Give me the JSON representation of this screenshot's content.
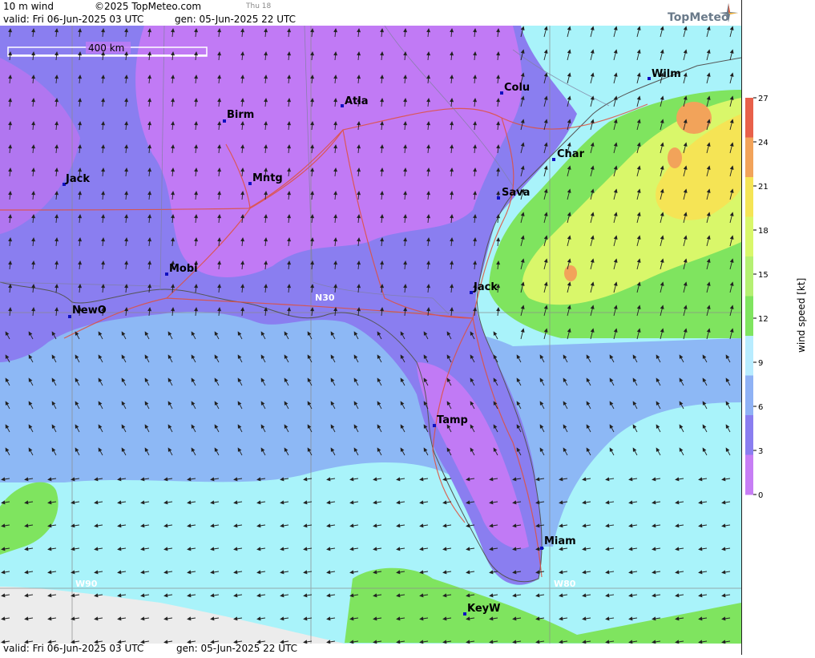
{
  "header": {
    "product": "10 m wind",
    "copyright": "©2025 TopMeteo.com",
    "day_hint": "Thu 18",
    "valid": "valid:  Fri  06-Jun-2025  03 UTC",
    "gen": "gen: 05-Jun-2025 22 UTC",
    "logo": "TopMeteo"
  },
  "footer": {
    "valid": "valid:  Fri  06-Jun-2025  03 UTC",
    "gen": "gen: 05-Jun-2025 22 UTC"
  },
  "scale_bar": {
    "label": "400 km"
  },
  "grid_labels": {
    "lat": "N30",
    "lon1": "W90",
    "lon2": "W80"
  },
  "cities": [
    {
      "name": "Wilm"
    },
    {
      "name": "Atla"
    },
    {
      "name": "Colu"
    },
    {
      "name": "Birm"
    },
    {
      "name": "Char"
    },
    {
      "name": "Jack"
    },
    {
      "name": "Mntg"
    },
    {
      "name": "Sava"
    },
    {
      "name": "Mobi"
    },
    {
      "name": "Jack"
    },
    {
      "name": "NewO"
    },
    {
      "name": "Tamp"
    },
    {
      "name": "Miam"
    },
    {
      "name": "KeyW"
    }
  ],
  "legend": {
    "title": "wind speed  [kt]",
    "ticks": [
      "27",
      "24",
      "21",
      "18",
      "15",
      "12",
      "9",
      "6",
      "3",
      "0"
    ],
    "colors": [
      "#e8604a",
      "#f2a35a",
      "#f5e455",
      "#d9f76a",
      "#b5f072",
      "#7fe45f",
      "#b8ecff",
      "#8fb2f5",
      "#8a7ef0",
      "#c77ef5"
    ]
  }
}
